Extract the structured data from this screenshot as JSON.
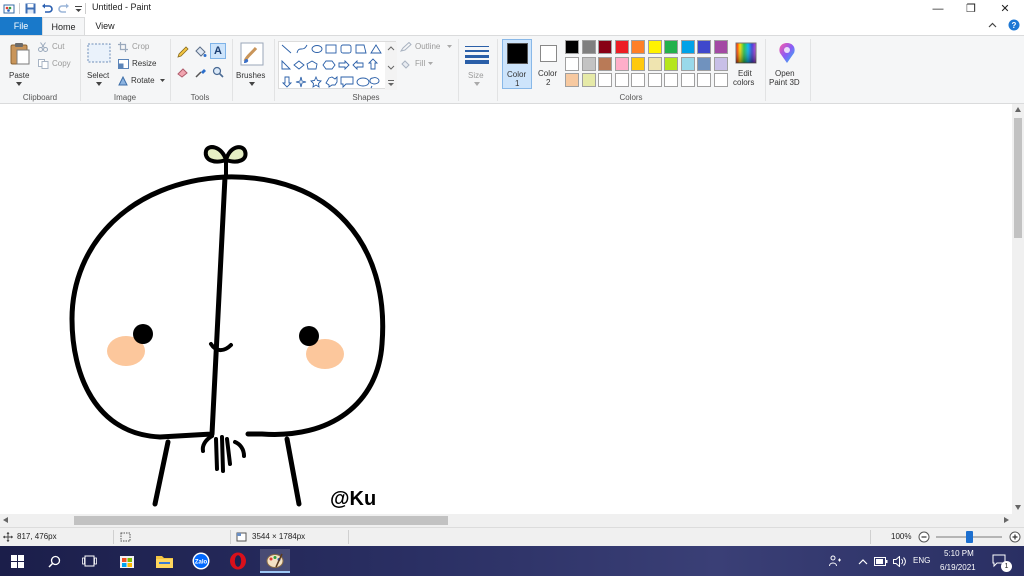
{
  "window": {
    "title": "Untitled - Paint",
    "minimize": "—",
    "restore": "❐",
    "close": "✕"
  },
  "tabs": {
    "file": "File",
    "home": "Home",
    "view": "View"
  },
  "ribbon": {
    "clipboard": {
      "label": "Clipboard",
      "paste": "Paste",
      "cut": "Cut",
      "copy": "Copy"
    },
    "image": {
      "label": "Image",
      "select": "Select",
      "crop": "Crop",
      "resize": "Resize",
      "rotate": "Rotate"
    },
    "tools": {
      "label": "Tools"
    },
    "brushes": {
      "label": "Brushes"
    },
    "shapes": {
      "label": "Shapes",
      "outline": "Outline",
      "fill": "Fill"
    },
    "size": {
      "label": "Size"
    },
    "colors": {
      "label": "Colors",
      "color1": "Color 1",
      "color2": "Color 2",
      "color1_line1": "Color",
      "color1_line2": "1",
      "color2_line1": "Color",
      "color2_line2": "2",
      "edit_line1": "Edit",
      "edit_line2": "colors",
      "open_line1": "Open",
      "open_line2": "Paint 3D",
      "color1_value": "#000000",
      "color2_value": "#ffffff",
      "palette_row1": [
        "#000000",
        "#7f7f7f",
        "#880015",
        "#ed1c24",
        "#ff7f27",
        "#fff200",
        "#22b14c",
        "#00a2e8",
        "#3f48cc",
        "#a349a4"
      ],
      "palette_row2": [
        "#ffffff",
        "#c3c3c3",
        "#b97a57",
        "#ffaec9",
        "#ffc90e",
        "#efe4b0",
        "#b5e61d",
        "#99d9ea",
        "#7092be",
        "#c8bfe7"
      ],
      "palette_row3": [
        "#f7c9a0",
        "#e6eaa8",
        "#ffffff",
        "#ffffff",
        "#ffffff",
        "#ffffff",
        "#ffffff",
        "#ffffff",
        "#ffffff",
        "#ffffff"
      ]
    }
  },
  "canvas": {
    "signature": "@Ku",
    "cheek_color": "#fcc79c",
    "leaf_color": "#e6efc4"
  },
  "status": {
    "cursor_pos": "817, 476px",
    "canvas_size": "3544 × 1784px",
    "zoom": "100%"
  },
  "taskbar": {
    "lang": "ENG",
    "time": "5:10 PM",
    "date": "6/19/2021",
    "notif_count": "1"
  }
}
